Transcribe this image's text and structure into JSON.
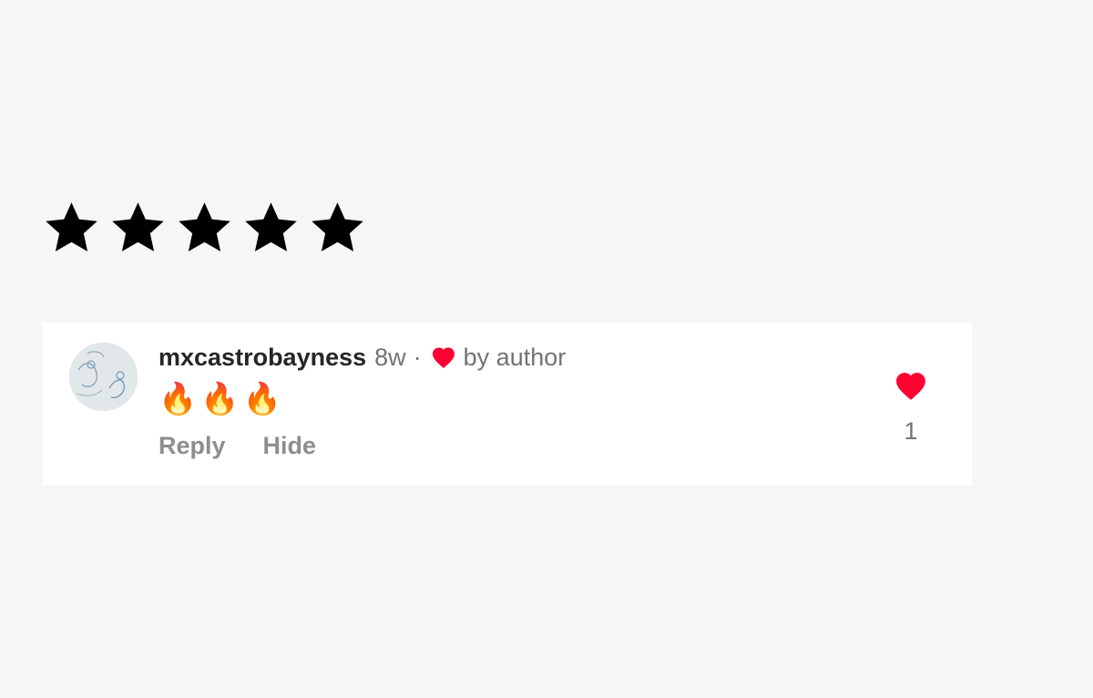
{
  "rating": {
    "stars": 5,
    "max": 5,
    "color": "#000000"
  },
  "comment": {
    "username": "mxcastrobayness",
    "time": "8w",
    "separator": "·",
    "liked_by_author": "by author",
    "text": "🔥🔥🔥",
    "actions": {
      "reply": "Reply",
      "hide": "Hide"
    },
    "like_count": "1",
    "heart_color": "#ff0033",
    "avatar_icon": "avatar"
  }
}
